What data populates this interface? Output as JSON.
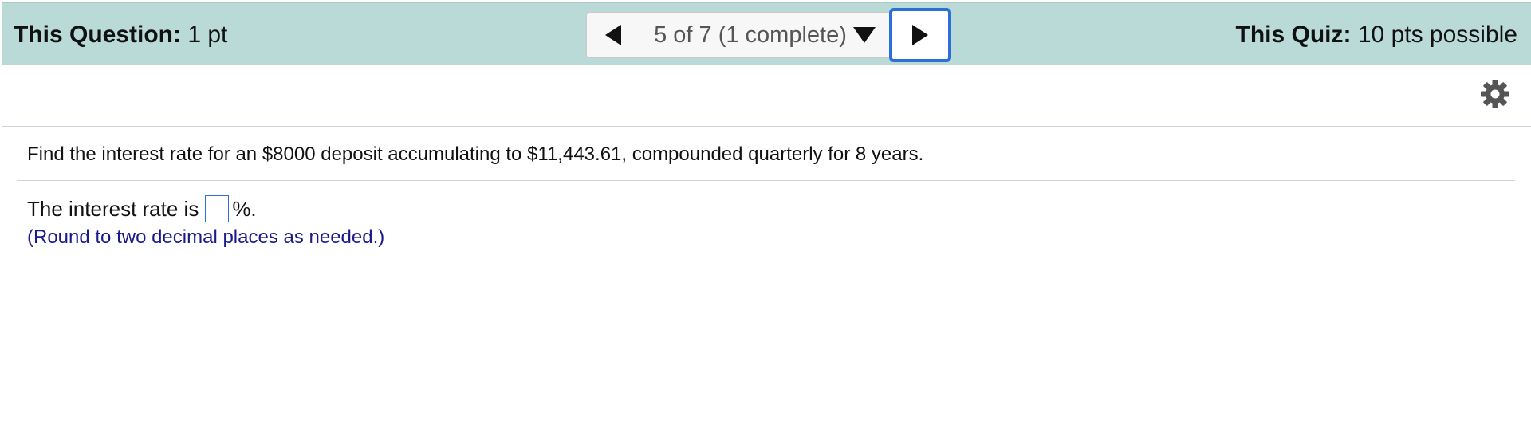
{
  "header": {
    "question_label": "This Question:",
    "question_value": "1 pt",
    "quiz_label": "This Quiz:",
    "quiz_value": "10 pts possible",
    "nav": {
      "status": "5 of 7 (1 complete)",
      "prev_icon": "triangle-left",
      "next_icon": "triangle-right",
      "dropdown_icon": "triangle-down"
    }
  },
  "toolbar": {
    "settings_icon": "gear"
  },
  "question": {
    "text": "Find the interest rate for an $8000 deposit accumulating to $11,443.61, compounded quarterly for 8 years.",
    "answer_prefix": "The interest rate is",
    "answer_value": "",
    "answer_suffix": "%.",
    "hint": "(Round to two decimal places as needed.)"
  },
  "colors": {
    "header_bg": "#b9dad6",
    "focus_accent": "#2d6fd6",
    "hint_text": "#1a1a8c"
  }
}
